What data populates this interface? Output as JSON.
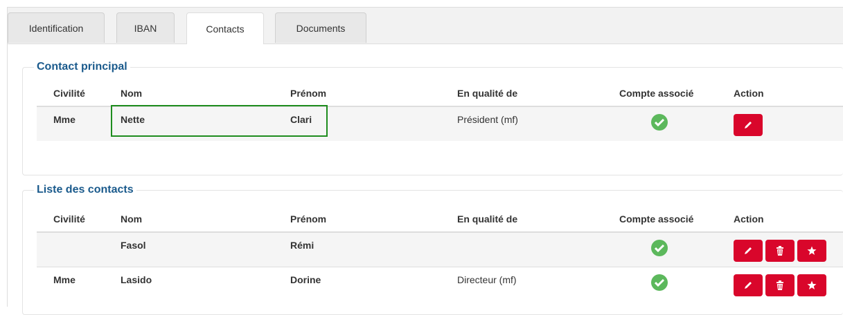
{
  "tabs": [
    {
      "label": "Identification"
    },
    {
      "label": "IBAN"
    },
    {
      "label": "Contacts"
    },
    {
      "label": "Documents"
    }
  ],
  "columns": {
    "civilite": "Civilité",
    "nom": "Nom",
    "prenom": "Prénom",
    "qualite": "En qualité de",
    "compte": "Compte associé",
    "action": "Action"
  },
  "contact_principal": {
    "title": "Contact principal",
    "rows": [
      {
        "civilite": "Mme",
        "nom": "Nette",
        "prenom": "Clari",
        "qualite": "Président (mf)",
        "compte_associe": true
      }
    ]
  },
  "liste_contacts": {
    "title": "Liste des contacts",
    "rows": [
      {
        "civilite": "",
        "nom": "Fasol",
        "prenom": "Rémi",
        "qualite": "",
        "compte_associe": true
      },
      {
        "civilite": "Mme",
        "nom": "Lasido",
        "prenom": "Dorine",
        "qualite": "Directeur (mf)",
        "compte_associe": true
      }
    ]
  },
  "icons": {
    "check": "check-circle-icon",
    "edit": "pencil-icon",
    "delete": "trash-icon",
    "favorite": "star-icon"
  },
  "colors": {
    "legend": "#1a5a8c",
    "danger": "#d9062b",
    "success": "#5cb85c",
    "highlight": "#1e8c1e"
  }
}
